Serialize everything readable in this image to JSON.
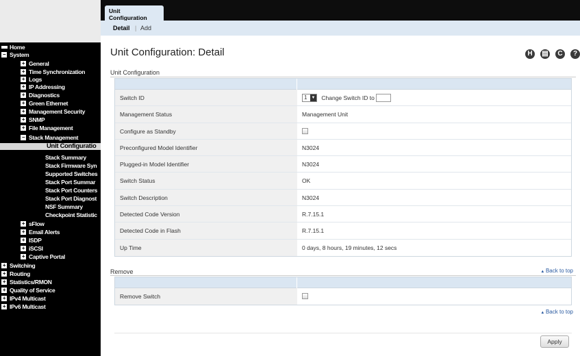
{
  "tabs": {
    "active": "Unit Configuration"
  },
  "subtabs": {
    "detail": "Detail",
    "add": "Add"
  },
  "page_title": "Unit Configuration: Detail",
  "toolbar": {
    "save": "H",
    "print": "▤",
    "refresh": "C",
    "help": "?"
  },
  "nav": [
    {
      "label": "Home",
      "type": "home"
    },
    {
      "label": "System",
      "type": "minus"
    },
    {
      "label": "General",
      "type": "plus"
    },
    {
      "label": "Time Synchronization",
      "type": "plus"
    },
    {
      "label": "Logs",
      "type": "plus"
    },
    {
      "label": "IP Addressing",
      "type": "plus"
    },
    {
      "label": "Diagnostics",
      "type": "plus"
    },
    {
      "label": "Green Ethernet",
      "type": "plus"
    },
    {
      "label": "Management Security",
      "type": "plus"
    },
    {
      "label": "SNMP",
      "type": "plus"
    },
    {
      "label": "File Management",
      "type": "plus"
    },
    {
      "label": "Stack Management",
      "type": "minus"
    },
    {
      "label": "Unit Configuratio",
      "type": "leaf",
      "selected": true
    },
    {
      "label": "Stack Summary",
      "type": "leaf"
    },
    {
      "label": "Stack Firmware Syn",
      "type": "leaf"
    },
    {
      "label": "Supported Switches",
      "type": "leaf"
    },
    {
      "label": "Stack Port Summar",
      "type": "leaf"
    },
    {
      "label": "Stack Port Counters",
      "type": "leaf"
    },
    {
      "label": "Stack Port Diagnost",
      "type": "leaf"
    },
    {
      "label": "NSF Summary",
      "type": "leaf"
    },
    {
      "label": "Checkpoint Statistic",
      "type": "leaf"
    },
    {
      "label": "sFlow",
      "type": "plus"
    },
    {
      "label": "Email Alerts",
      "type": "plus"
    },
    {
      "label": "ISDP",
      "type": "plus"
    },
    {
      "label": "iSCSI",
      "type": "plus"
    },
    {
      "label": "Captive Portal",
      "type": "plus"
    },
    {
      "label": "Switching",
      "type": "plus-top"
    },
    {
      "label": "Routing",
      "type": "plus-top"
    },
    {
      "label": "Statistics/RMON",
      "type": "plus-top"
    },
    {
      "label": "Quality of Service",
      "type": "plus-top"
    },
    {
      "label": "IPv4 Multicast",
      "type": "plus-top"
    },
    {
      "label": "IPv6 Multicast",
      "type": "plus-top"
    }
  ],
  "unit_config": {
    "section_label": "Unit Configuration",
    "switch_id_label": "Switch ID",
    "switch_id_value": "1",
    "change_switch_id_label": "Change Switch ID to",
    "rows": [
      {
        "label": "Management Status",
        "value": "Management Unit"
      },
      {
        "label": "Configure as Standby",
        "value": ""
      },
      {
        "label": "Preconfigured Model Identifier",
        "value": "N3024"
      },
      {
        "label": "Plugged-in Model Identifier",
        "value": "N3024"
      },
      {
        "label": "Switch Status",
        "value": "OK"
      },
      {
        "label": "Switch Description",
        "value": "N3024"
      },
      {
        "label": "Detected Code Version",
        "value": "R.7.15.1"
      },
      {
        "label": "Detected Code in Flash",
        "value": "R.7.15.1"
      },
      {
        "label": "Up Time",
        "value": "0 days, 8 hours, 19 minutes, 12 secs"
      }
    ]
  },
  "remove": {
    "section_label": "Remove",
    "back_to_top": "Back to top",
    "row_label": "Remove Switch",
    "back_to_top_2": "Back to top"
  },
  "apply_label": "Apply"
}
